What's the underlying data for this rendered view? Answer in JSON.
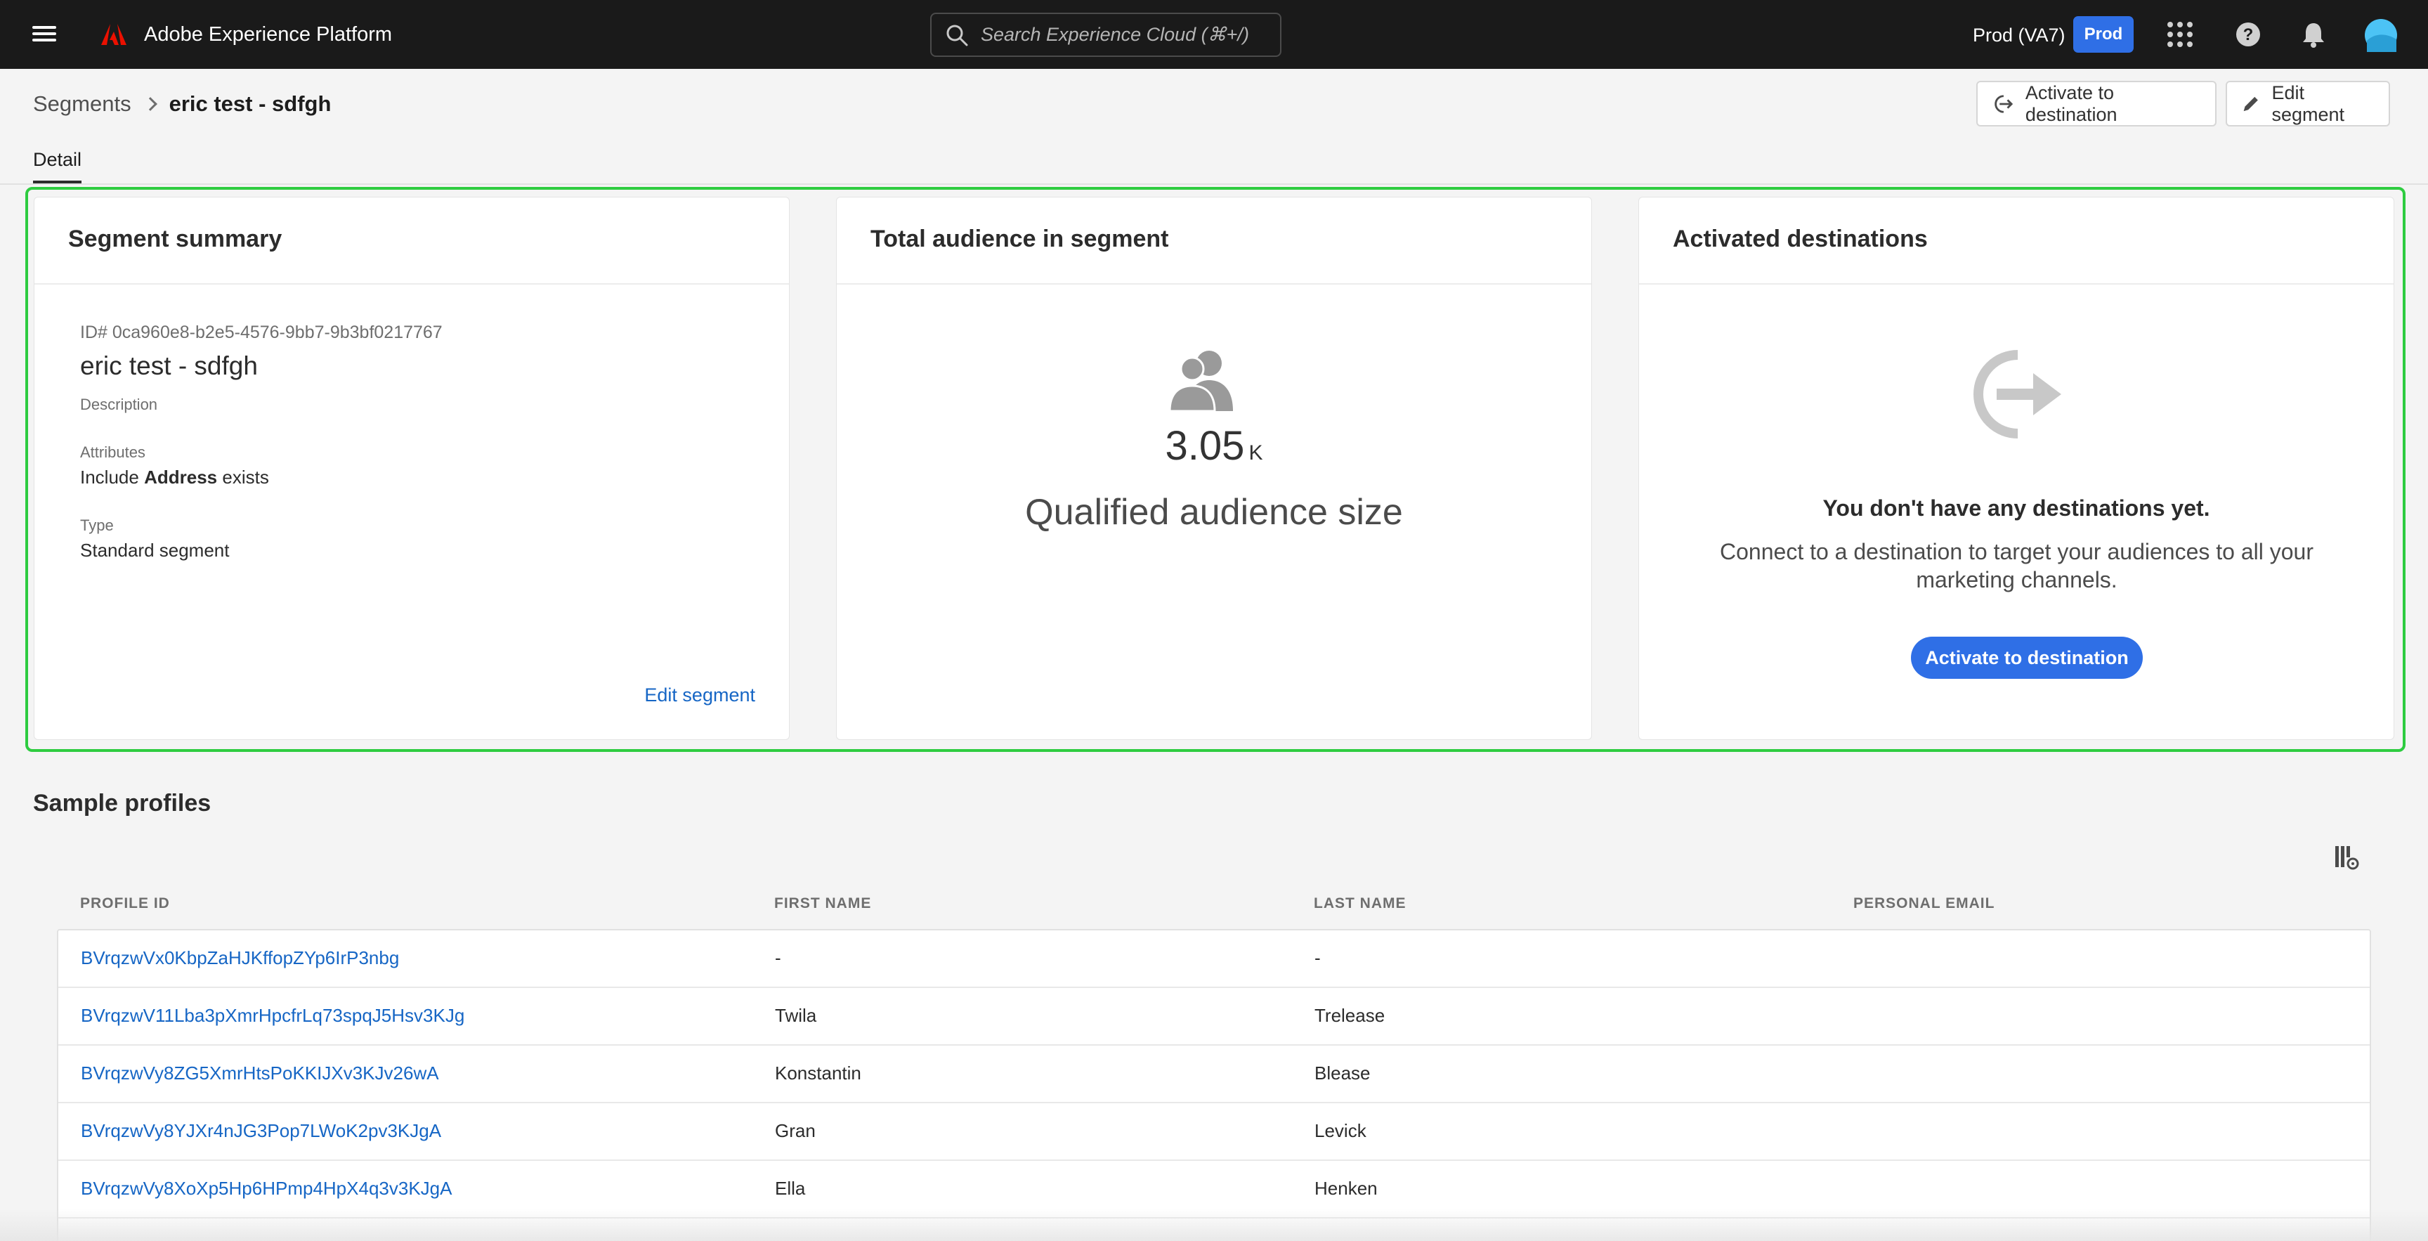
{
  "topbar": {
    "brand": "Adobe Experience Platform",
    "search_placeholder": "Search Experience Cloud (⌘+/)",
    "org": "Prod (VA7)",
    "env_badge": "Prod"
  },
  "breadcrumb": {
    "parent": "Segments",
    "current": "eric test - sdfgh"
  },
  "actions": {
    "activate": "Activate to destination",
    "edit": "Edit segment"
  },
  "tabs": [
    "Detail"
  ],
  "summary": {
    "title": "Segment summary",
    "id": "ID# 0ca960e8-b2e5-4576-9bb7-9b3bf0217767",
    "name": "eric test - sdfgh",
    "description_label": "Description",
    "attributes_label": "Attributes",
    "attributes_pre": "Include",
    "attributes_bold": "Address",
    "attributes_post": "exists",
    "type_label": "Type",
    "type_value": "Standard segment",
    "edit_link": "Edit segment"
  },
  "audience": {
    "title": "Total audience in segment",
    "value": "3.05",
    "unit": "K",
    "label": "Qualified audience size"
  },
  "destinations": {
    "title": "Activated destinations",
    "empty_title": "You don't have any destinations yet.",
    "empty_desc": "Connect to a destination to target your audiences to all your marketing channels.",
    "button": "Activate to destination"
  },
  "profiles": {
    "title": "Sample profiles",
    "columns": [
      "PROFILE ID",
      "FIRST NAME",
      "LAST NAME",
      "PERSONAL EMAIL"
    ],
    "rows": [
      {
        "id": "BVrqzwVx0KbpZaHJKffopZYp6IrP3nbg",
        "first": "-",
        "last": "-",
        "email": ""
      },
      {
        "id": "BVrqzwV11Lba3pXmrHpcfrLq73spqJ5Hsv3KJg",
        "first": "Twila",
        "last": "Trelease",
        "email": ""
      },
      {
        "id": "BVrqzwVy8ZG5XmrHtsPoKKIJXv3KJv26wA",
        "first": "Konstantin",
        "last": "Blease",
        "email": ""
      },
      {
        "id": "BVrqzwVy8YJXr4nJG3Pop7LWoK2pv3KJgA",
        "first": "Gran",
        "last": "Levick",
        "email": ""
      },
      {
        "id": "BVrqzwVy8XoXp5Hp6HPmp4HpX4q3v3KJgA",
        "first": "Ella",
        "last": "Henken",
        "email": ""
      }
    ]
  },
  "colors": {
    "accent": "#2f6fe6",
    "link": "#1666c5",
    "highlight": "#2ecc40"
  }
}
